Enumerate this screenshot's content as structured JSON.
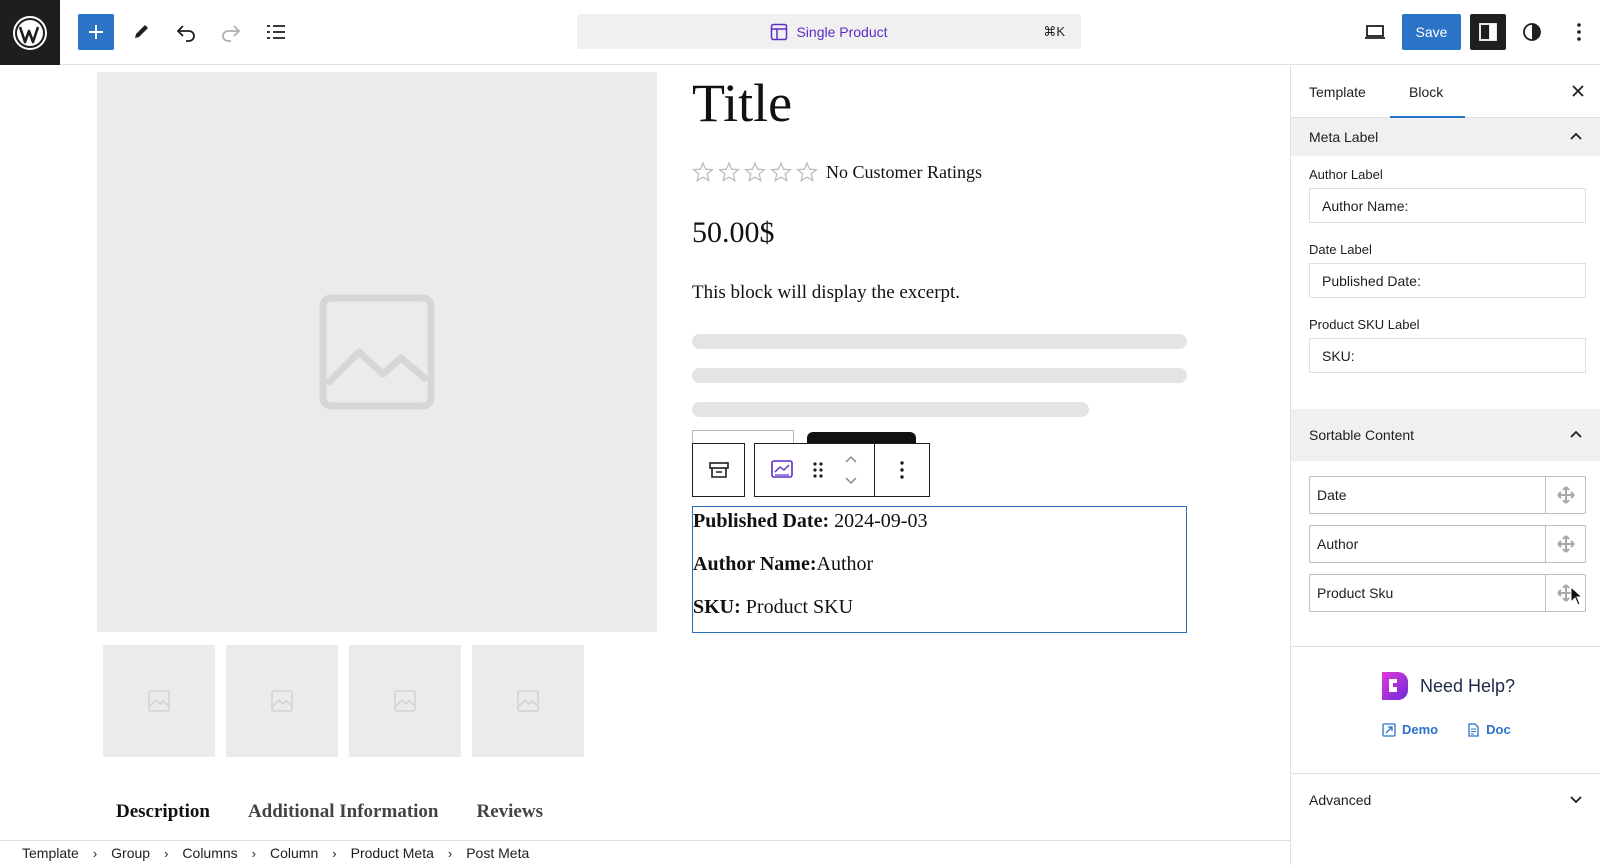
{
  "topbar": {
    "doc_title": "Single Product",
    "shortcut": "⌘K",
    "save_label": "Save"
  },
  "product": {
    "title": "Title",
    "rating_text": "No Customer Ratings",
    "star_count": 5,
    "price": "50.00$",
    "excerpt": "This block will display the excerpt."
  },
  "post_meta": {
    "date_label": "Published Date:",
    "date_value": " 2024-09-03",
    "author_label": "Author Name:",
    "author_value": "Author",
    "sku_label": "SKU:",
    "sku_value": " Product SKU"
  },
  "product_tabs": [
    "Description",
    "Additional Information",
    "Reviews"
  ],
  "breadcrumb": [
    "Template",
    "Group",
    "Columns",
    "Column",
    "Product Meta",
    "Post Meta"
  ],
  "sidebar": {
    "tabs": [
      "Template",
      "Block"
    ],
    "active_tab": "Block",
    "meta_label_panel": {
      "title": "Meta Label",
      "author_label": "Author Label",
      "author_value": "Author Name:",
      "date_label": "Date Label",
      "date_value": "Published Date:",
      "sku_label": "Product SKU Label",
      "sku_value": "SKU:"
    },
    "sortable_panel": {
      "title": "Sortable Content",
      "items": [
        "Date",
        "Author",
        "Product Sku"
      ]
    },
    "help": {
      "title": "Need Help?",
      "demo": "Demo",
      "doc": "Doc"
    },
    "advanced": "Advanced"
  },
  "colors": {
    "accent": "#2a73c7",
    "doc_title": "#5b2cc6",
    "dark": "#1e1e1e"
  }
}
